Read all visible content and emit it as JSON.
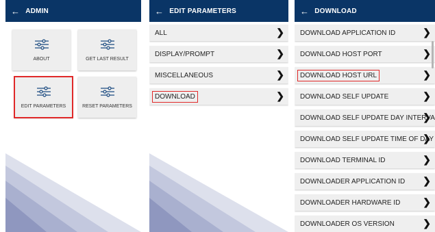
{
  "admin": {
    "title": "ADMIN",
    "tiles": [
      {
        "label": "ABOUT",
        "icon": "sliders-icon"
      },
      {
        "label": "GET LAST RESULT",
        "icon": "sliders-icon"
      },
      {
        "label": "EDIT PARAMETERS",
        "icon": "sliders-icon",
        "selected": true
      },
      {
        "label": "RESET PARAMETERS",
        "icon": "sliders-icon"
      }
    ]
  },
  "edit": {
    "title": "EDIT PARAMETERS",
    "items": [
      {
        "label": "ALL"
      },
      {
        "label": "DISPLAY/PROMPT"
      },
      {
        "label": "MISCELLANEOUS"
      },
      {
        "label": "DOWNLOAD",
        "selected": true
      }
    ]
  },
  "download": {
    "title": "DOWNLOAD",
    "items": [
      {
        "label": "DOWNLOAD APPLICATION ID"
      },
      {
        "label": "DOWNLOAD HOST PORT"
      },
      {
        "label": "DOWNLOAD HOST URL",
        "selected": true
      },
      {
        "label": "DOWNLOAD SELF UPDATE"
      },
      {
        "label": "DOWNLOAD SELF UPDATE DAY INTERVAL"
      },
      {
        "label": "DOWNLOAD SELF UPDATE TIME OF DAY"
      },
      {
        "label": "DOWNLOAD TERMINAL ID"
      },
      {
        "label": "DOWNLOADER APPLICATION ID"
      },
      {
        "label": "DOWNLOADER HARDWARE ID"
      },
      {
        "label": "DOWNLOADER OS VERSION"
      }
    ]
  },
  "icons": {
    "back": "←",
    "chevron": "❯"
  },
  "colors": {
    "header": "#0a3566",
    "highlight": "#e02828",
    "row": "#efefef"
  }
}
